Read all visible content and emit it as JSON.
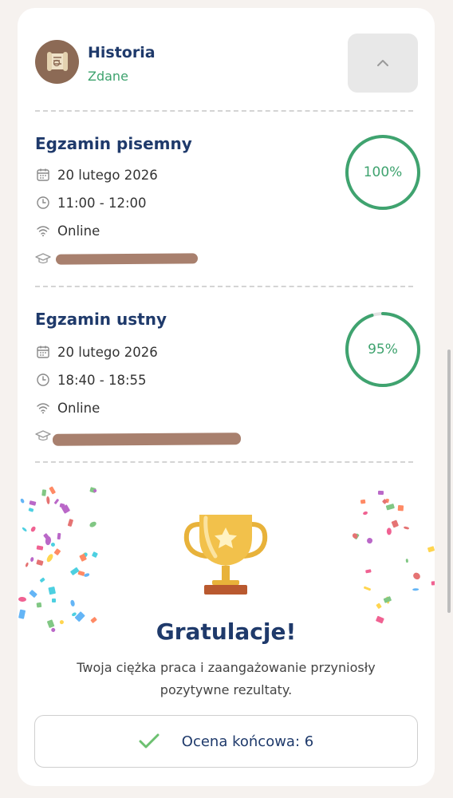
{
  "subject": {
    "name": "Historia",
    "status": "Zdane",
    "avatar_icon": "scroll-icon",
    "collapse_icon": "chevron-up-icon"
  },
  "exams": [
    {
      "title": "Egzamin pisemny",
      "date": "20 lutego 2026",
      "time": "11:00 - 12:00",
      "mode": "Online",
      "score_label": "100%",
      "score_fraction": 1.0
    },
    {
      "title": "Egzamin ustny",
      "date": "20 lutego 2026",
      "time": "18:40 - 18:55",
      "mode": "Online",
      "score_label": "95%",
      "score_fraction": 0.95
    }
  ],
  "congrats": {
    "title": "Gratulacje!",
    "message": "Twoja ciężka praca i zaangażowanie przyniosły pozytywne rezultaty.",
    "trophy_icon": "trophy-icon"
  },
  "final_grade": {
    "label": "Ocena końcowa: 6",
    "icon": "checkmark-icon"
  },
  "colors": {
    "accent_green": "#3fa36f",
    "title_navy": "#1f3a6b",
    "avatar_brown": "#8c6a55",
    "ring_track": "#e2e2e2"
  }
}
